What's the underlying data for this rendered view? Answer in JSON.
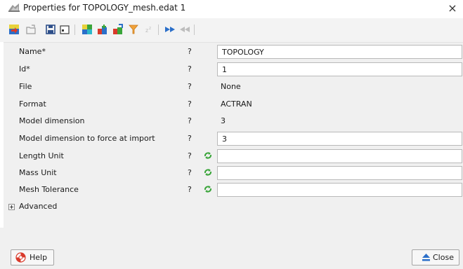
{
  "window": {
    "title": "Properties for TOPOLOGY_mesh.edat 1",
    "close_glyph": "×"
  },
  "toolbar": {
    "icons": [
      "import-icon",
      "open-icon",
      "save-icon",
      "window-icon",
      "color-icon",
      "add-component-icon",
      "edit-component-icon",
      "filter-icon",
      "zoom-icon",
      "expand-icon",
      "collapse-icon"
    ]
  },
  "properties": [
    {
      "label": "Name*",
      "help": "?",
      "kind": "input",
      "value": "TOPOLOGY"
    },
    {
      "label": "Id*",
      "help": "?",
      "kind": "input",
      "value": "1"
    },
    {
      "label": "File",
      "help": "?",
      "kind": "text",
      "value": "None"
    },
    {
      "label": "Format",
      "help": "?",
      "kind": "text",
      "value": "ACTRAN"
    },
    {
      "label": "Model dimension",
      "help": "?",
      "kind": "text",
      "value": "3"
    },
    {
      "label": "Model dimension to force at import",
      "help": "?",
      "kind": "input",
      "value": "3"
    },
    {
      "label": "Length Unit",
      "help": "?",
      "kind": "input-recycle",
      "value": ""
    },
    {
      "label": "Mass Unit",
      "help": "?",
      "kind": "input-recycle",
      "value": ""
    },
    {
      "label": "Mesh Tolerance",
      "help": "?",
      "kind": "input-recycle",
      "value": ""
    }
  ],
  "advanced": {
    "label": "Advanced"
  },
  "footer": {
    "help_label": "Help",
    "close_label": "Close"
  },
  "colors": {
    "panel": "#f0f0f0",
    "accent_green": "#3aa53a",
    "input_border": "#b9b9b9"
  }
}
